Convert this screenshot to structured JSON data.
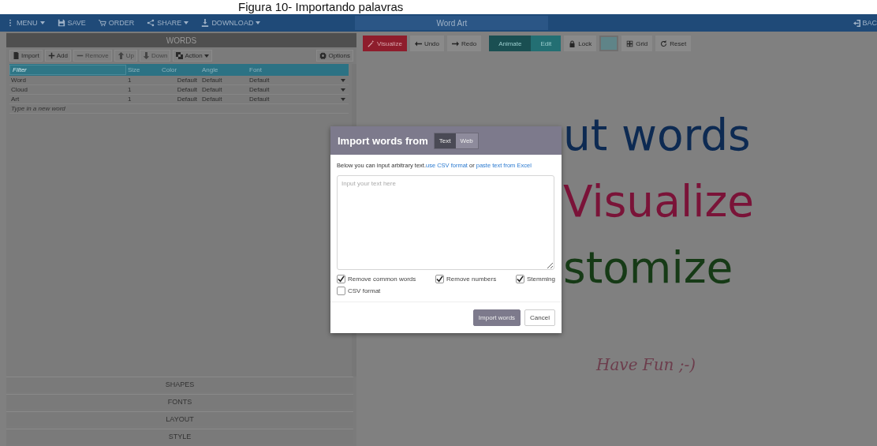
{
  "caption": "Figura 10- Importando palavras",
  "menubar": {
    "items": [
      {
        "label": "MENU",
        "dropdown": true
      },
      {
        "label": "SAVE",
        "dropdown": false
      },
      {
        "label": "ORDER",
        "dropdown": false
      },
      {
        "label": "SHARE",
        "dropdown": true
      },
      {
        "label": "DOWNLOAD",
        "dropdown": true
      }
    ],
    "title": "Word Art",
    "back": "BAC"
  },
  "words_panel": {
    "title": "WORDS",
    "toolbar": [
      {
        "label": "Import",
        "disabled": false,
        "dropdown": false
      },
      {
        "label": "Add",
        "disabled": false,
        "dropdown": false
      },
      {
        "label": "Remove",
        "disabled": true,
        "dropdown": false
      },
      {
        "label": "Up",
        "disabled": true,
        "dropdown": false
      },
      {
        "label": "Down",
        "disabled": true,
        "dropdown": false
      },
      {
        "label": "Action",
        "disabled": false,
        "dropdown": true
      }
    ],
    "options": "Options",
    "table": {
      "columns": [
        {
          "kind": "filter",
          "placeholder": "Filter"
        },
        {
          "kind": "heading",
          "label": "Size"
        },
        {
          "kind": "heading",
          "label": "Color"
        },
        {
          "kind": "heading",
          "label": "Angle"
        },
        {
          "kind": "heading",
          "label": "Font"
        }
      ],
      "rows": [
        [
          "Word",
          "1",
          "Default",
          "Default",
          "Default"
        ],
        [
          "Cloud",
          "1",
          "Default",
          "Default",
          "Default"
        ],
        [
          "Art",
          "1",
          "Default",
          "Default",
          "Default"
        ]
      ],
      "new_word": {
        "placeholder": "Type in a new word"
      }
    }
  },
  "sections": [
    "SHAPES",
    "FONTS",
    "LAYOUT",
    "STYLE"
  ],
  "canvas_toolbar": [
    {
      "label": "Visualize",
      "kind": "primary"
    },
    {
      "label": "Undo",
      "kind": "plain"
    },
    {
      "label": "Redo",
      "kind": "plain"
    },
    {
      "label": "Animate",
      "kind": "toggle",
      "selected": true
    },
    {
      "label": "Edit",
      "kind": "toggle",
      "selected": false
    },
    {
      "label": "Lock",
      "kind": "plain"
    },
    {
      "kind": "swatch"
    },
    {
      "label": "Grid",
      "kind": "plain"
    },
    {
      "label": "Reset",
      "kind": "plain"
    }
  ],
  "canvas_words": [
    {
      "text": "ut words",
      "color": "#0d2a52"
    },
    {
      "text": "Visualize",
      "color": "#7a1338"
    },
    {
      "text": "stomize",
      "color": "#163a16"
    }
  ],
  "tagline": "Have Fun ;-)",
  "dialog": {
    "title": "Import words from",
    "sources": [
      {
        "label": "Text",
        "selected": true
      },
      {
        "label": "Web",
        "selected": false
      }
    ],
    "intro": "Below you can input arbitrary text.",
    "link_1": "use CSV format",
    "or": " or ",
    "link_2": "paste text from Excel",
    "input": {
      "placeholder": "Input your text here"
    },
    "options": [
      {
        "label": "Remove common words",
        "checked": true
      },
      {
        "label": "Remove numbers",
        "checked": true
      },
      {
        "label": "Stemming",
        "checked": true
      },
      {
        "label": "CSV format",
        "checked": false
      }
    ],
    "buttons": [
      {
        "label": "Import words",
        "kind": "primary"
      },
      {
        "label": "Cancel",
        "kind": "default"
      }
    ]
  }
}
